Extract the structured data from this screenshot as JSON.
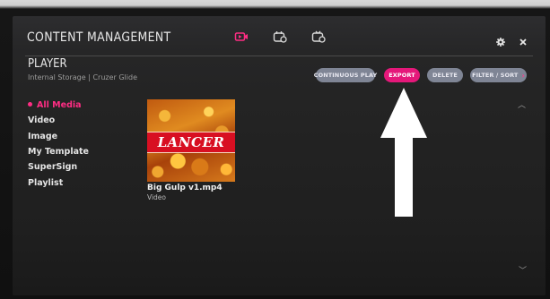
{
  "header": {
    "title": "CONTENT MANAGEMENT",
    "mode_icons": [
      "player-icon",
      "scheduler-icon",
      "editor-icon"
    ],
    "settings_icon": "gear-icon",
    "close_icon": "close-icon"
  },
  "section": {
    "title": "PLAYER",
    "location": "Internal Storage | Cruzer Glide"
  },
  "toolbar": {
    "continuous_play": "CONTINUOUS PLAY",
    "export": "EXPORT",
    "delete": "DELETE",
    "filter_sort": "FILTER / SORT",
    "filter_chevron": "›"
  },
  "sidebar": {
    "items": [
      {
        "label": "All Media",
        "active": true
      },
      {
        "label": "Video"
      },
      {
        "label": "Image"
      },
      {
        "label": "My Template"
      },
      {
        "label": "SuperSign"
      },
      {
        "label": "Playlist"
      }
    ]
  },
  "media": [
    {
      "thumb_text": "LANCER",
      "name": "Big Gulp v1.mp4",
      "type": "Video"
    }
  ],
  "scroll": {
    "up": "︿",
    "down": "﹀"
  },
  "colors": {
    "accent": "#e5187a",
    "button_gray": "#7f8595",
    "background": "#242424"
  }
}
